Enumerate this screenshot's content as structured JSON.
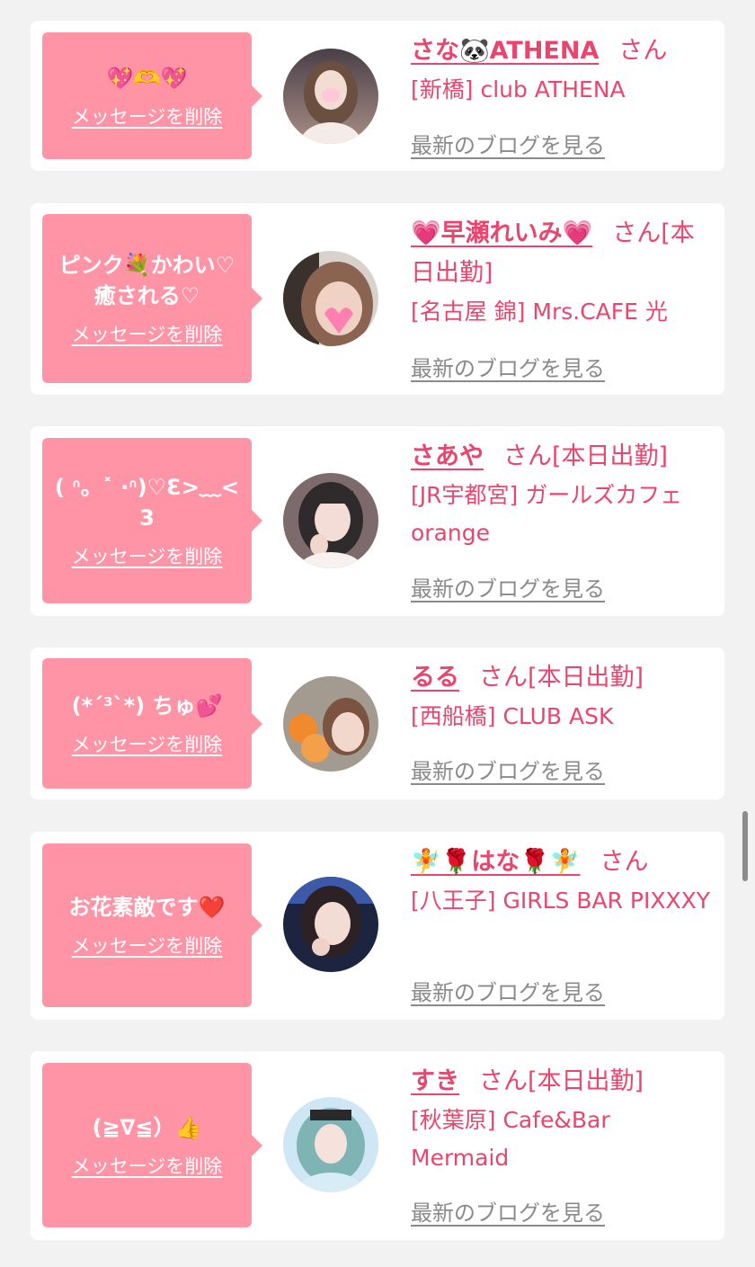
{
  "messages": [
    {
      "message": "💖🫶💖",
      "delete_label": "メッセージを削除",
      "name": "さな🐼ATHENA",
      "suffix": "さん",
      "shop": "[新橋] club ATHENA",
      "blog_label": "最新のブログを見る"
    },
    {
      "message": "ピンク💐かわい♡癒される♡",
      "delete_label": "メッセージを削除",
      "name": "💗早瀬れいみ💗",
      "suffix": "さん[本日出勤]",
      "shop": "[名古屋 錦] Mrs.CAFE 光",
      "blog_label": "最新のブログを見る"
    },
    {
      "message": "( ᐢ。˟ ·ᐢ)♡Ɛ>﹏<3",
      "delete_label": "メッセージを削除",
      "name": "さあや",
      "suffix": "さん[本日出勤]",
      "shop": "[JR宇都宮] ガールズカフェ orange",
      "blog_label": "最新のブログを見る"
    },
    {
      "message": "(*´³`*) ちゅ💕",
      "delete_label": "メッセージを削除",
      "name": "るる",
      "suffix": "さん[本日出勤]",
      "shop": "[西船橋] CLUB ASK",
      "blog_label": "最新のブログを見る"
    },
    {
      "message": "お花素敵です❤️",
      "delete_label": "メッセージを削除",
      "name": "🧚🌹はな🌹🧚",
      "suffix": "さん",
      "shop": "[八王子] GIRLS BAR PIXXXY",
      "blog_label": "最新のブログを見る"
    },
    {
      "message": "(≧∇≦）👍",
      "delete_label": "メッセージを削除",
      "name": "すき",
      "suffix": "さん[本日出勤]",
      "shop": "[秋葉原] Cafe&Bar Mermaid",
      "blog_label": "最新のブログを見る"
    }
  ],
  "colors": {
    "bubble": "#ff94a6",
    "name": "#e8466e",
    "link_gray": "#8a8a8a",
    "background": "#f2f2f2"
  }
}
